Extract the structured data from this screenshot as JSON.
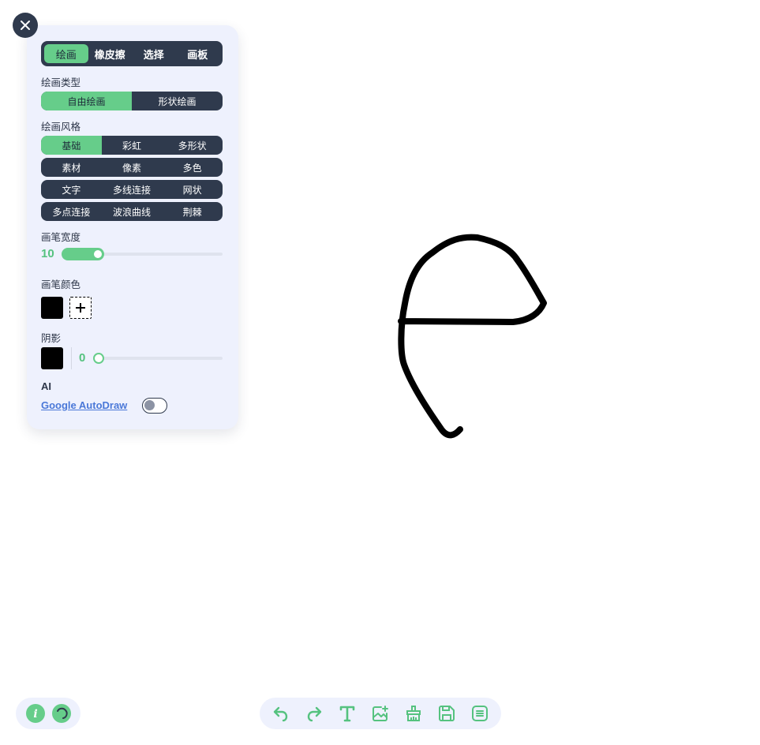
{
  "panel": {
    "tabs": [
      "绘画",
      "橡皮擦",
      "选择",
      "画板"
    ],
    "active_tab": "绘画",
    "draw_type": {
      "label": "绘画类型",
      "options": [
        "自由绘画",
        "形状绘画"
      ],
      "selected": "自由绘画"
    },
    "draw_style": {
      "label": "绘画风格",
      "rows": [
        [
          "基础",
          "彩虹",
          "多形状"
        ],
        [
          "素材",
          "像素",
          "多色"
        ],
        [
          "文字",
          "多线连接",
          "网状"
        ],
        [
          "多点连接",
          "波浪曲线",
          "荆棘"
        ]
      ],
      "selected": "基础"
    },
    "brush_width": {
      "label": "画笔宽度",
      "value": "10"
    },
    "brush_color": {
      "label": "画笔颜色",
      "color": "#000000"
    },
    "shadow": {
      "label": "阴影",
      "color": "#000000",
      "value": "0"
    },
    "ai": {
      "label": "AI",
      "link": "Google AutoDraw",
      "enabled": false
    }
  },
  "bottom_left": {
    "icons": [
      "info-icon",
      "theme-icon"
    ]
  },
  "toolbar": {
    "icons": [
      "undo-icon",
      "redo-icon",
      "text-icon",
      "add-image-icon",
      "clear-brush-icon",
      "save-icon",
      "menu-icon"
    ]
  },
  "colors": {
    "accent": "#66cd8a",
    "dark": "#2f3a4d",
    "panel_bg": "#eef1fd"
  }
}
